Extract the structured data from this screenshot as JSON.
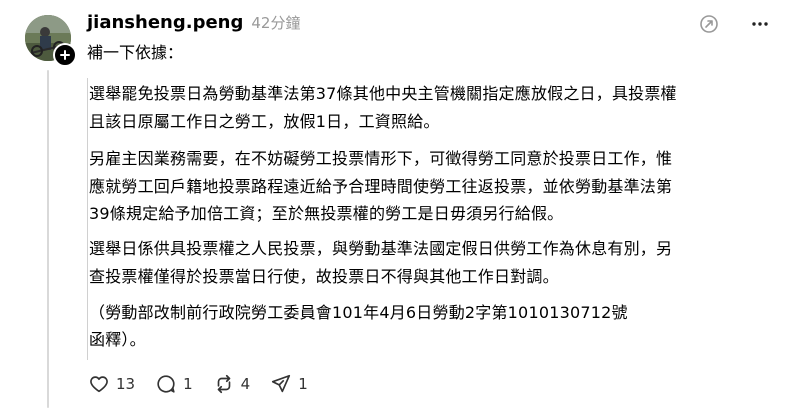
{
  "post": {
    "username": "jiansheng.peng",
    "timestamp": "42分鐘",
    "intro": "補一下依據：",
    "quote_lines": [
      "選舉罷免投票日為勞動基準法第37條其他中央主管機關指定應放假之日，具投票權",
      "且該日原屬工作日之勞工，放假1日，工資照給。",
      "另雇主因業務需要，在不妨礙勞工投票情形下，可徵得勞工同意於投票日工作，惟",
      "應就勞工回戶籍地投票路程遠近給予合理時間使勞工往返投票，並依勞動基準法第",
      "39條規定給予加倍工資；至於無投票權的勞工是日毋須另行給假。",
      "選舉日係供具投票權之人民投票，與勞動基準法國定假日供勞工作為休息有別，另",
      "查投票權僅得於投票當日行使，故投票日不得與其他工作日對調。",
      "（勞動部改制前行政院勞工委員會101年4月6日勞動2字第1010130712號",
      "函釋）。"
    ]
  },
  "actions": {
    "likes": "13",
    "replies": "1",
    "reposts": "4",
    "shares": "1"
  },
  "icons": {
    "avatar": "avatar-photo",
    "follow": "plus-icon",
    "menu": "more-icon",
    "like": "heart-icon",
    "reply": "comment-icon",
    "repost": "repost-icon",
    "share": "send-icon"
  }
}
